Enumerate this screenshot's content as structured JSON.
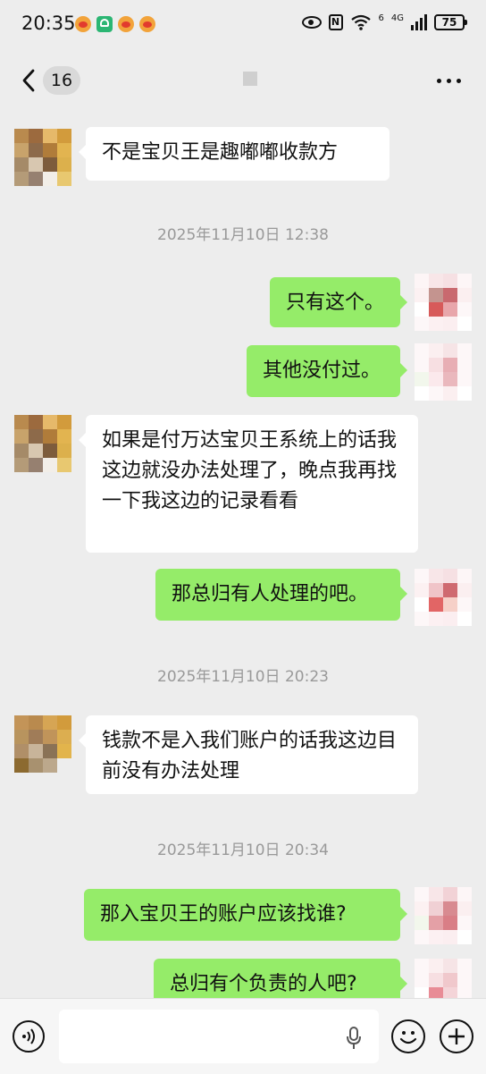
{
  "status_bar": {
    "time": "20:35",
    "network_label": "4G",
    "wifi_label": "6",
    "battery": "75"
  },
  "header": {
    "unread_count": "16"
  },
  "messages": [
    {
      "type": "in",
      "text": "不是宝贝王是趣嘟嘟收款方"
    },
    {
      "type": "time",
      "text": "2025年11月10日 12:38"
    },
    {
      "type": "out",
      "text": "只有这个。"
    },
    {
      "type": "out",
      "text": "其他没付过。"
    },
    {
      "type": "in",
      "text": "如果是付万达宝贝王系统上的话我这边就没办法处理了，晚点我再找一下我这边的记录看看"
    },
    {
      "type": "out",
      "text": "那总归有人处理的吧。"
    },
    {
      "type": "time",
      "text": "2025年11月10日 20:23"
    },
    {
      "type": "in",
      "text": "钱款不是入我们账户的话我这边目前没有办法处理"
    },
    {
      "type": "time",
      "text": "2025年11月10日 20:34"
    },
    {
      "type": "out",
      "text": "那入宝贝王的账户应该找谁?"
    },
    {
      "type": "out",
      "text": "总归有个负责的人吧?"
    }
  ],
  "colors": {
    "outgoing_bubble": "#95ec69",
    "incoming_bubble": "#ffffff",
    "background": "#ededed"
  },
  "icons": {
    "back": "chevron-left-icon",
    "more": "more-dots-icon",
    "voice": "voice-icon",
    "mic": "mic-icon",
    "emoji": "emoji-icon",
    "plus": "plus-icon"
  }
}
